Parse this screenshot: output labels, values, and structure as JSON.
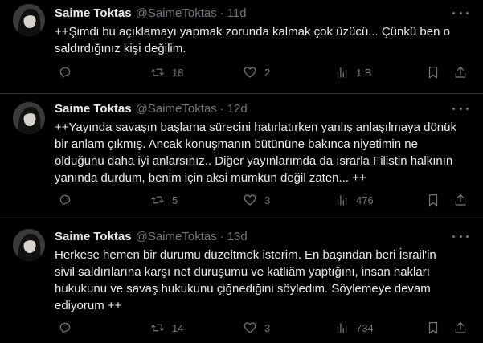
{
  "tweets": [
    {
      "author_name": "Saime Toktas",
      "handle": "@SaimeToktas",
      "separator": "·",
      "time": "11d",
      "text": "++Şimdi bu açıklamayı yapmak zorunda kalmak çok üzücü... Çünkü ben o\nsaldırdığınız kişi değilim.",
      "replies": "",
      "reposts": "18",
      "likes": "2",
      "views": "1 B"
    },
    {
      "author_name": "Saime Toktas",
      "handle": "@SaimeToktas",
      "separator": "·",
      "time": "12d",
      "text": "++Yayında savaşın başlama sürecini  hatırlatırken yanlış anlaşılmaya dönük\nbir anlam çıkmış. Ancak konuşmanın bütününe bakınca niyetimin ne\nolduğunu daha iyi anlarsınız.. Diğer yayınlarımda da ısrarla Filistin halkının\nyanında durdum, benim için aksi mümkün değil zaten... ++",
      "replies": "",
      "reposts": "5",
      "likes": "3",
      "views": "476"
    },
    {
      "author_name": "Saime Toktas",
      "handle": "@SaimeToktas",
      "separator": "·",
      "time": "13d",
      "text": "Herkese hemen bir durumu düzeltmek isterim. En başından beri İsrail'in\nsivil saldırılarına karşı net duruşumu ve katliâm yaptığını, insan hakları\nhukukunu ve savaş hukukunu çiğnediğini söyledim. Söylemeye devam\nediyorum ++",
      "replies": "",
      "reposts": "14",
      "likes": "3",
      "views": "734"
    }
  ],
  "icons": {
    "reply": "reply-icon",
    "repost": "repost-icon",
    "like": "heart-icon",
    "views": "views-chart-icon",
    "bookmark": "bookmark-icon",
    "share": "share-icon",
    "more": "more-dots-icon"
  },
  "colors": {
    "background": "#000000",
    "text": "#e7e9ea",
    "muted": "#71767b",
    "divider": "#2f3336"
  }
}
